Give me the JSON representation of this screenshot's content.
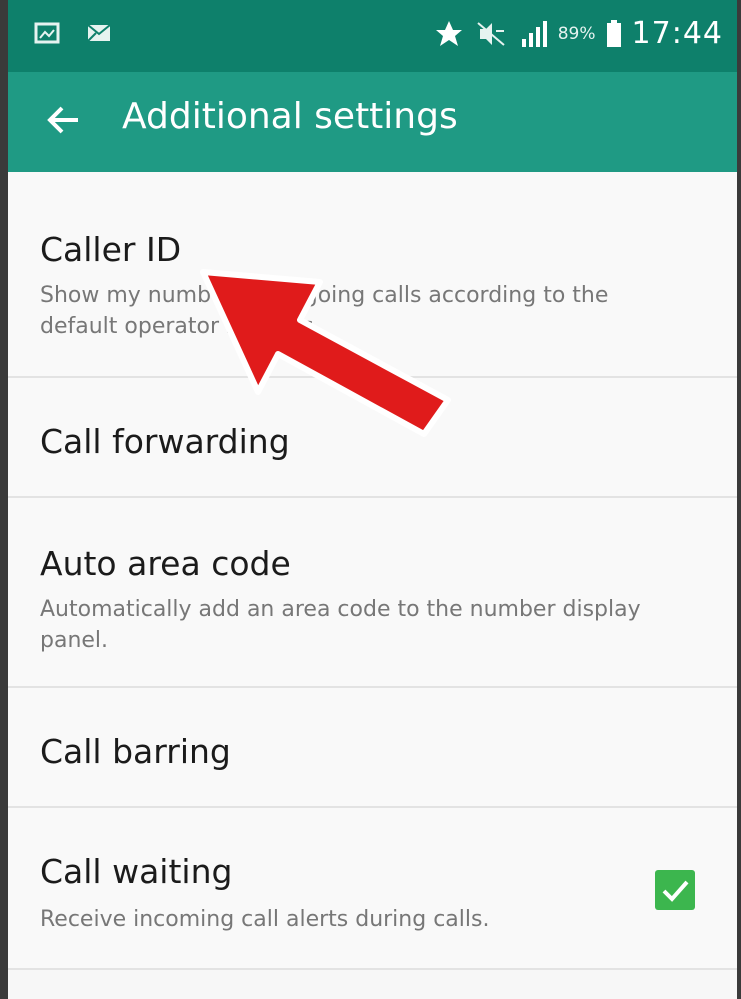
{
  "status_bar": {
    "left_icons": [
      "image-notification-icon",
      "mail-notification-icon"
    ],
    "right_icons": [
      "star-icon",
      "mute-icon",
      "signal-icon",
      "battery-icon"
    ],
    "battery": "89%",
    "time": "17:44"
  },
  "app_bar": {
    "back_icon": "arrow-left-icon",
    "title": "Additional settings",
    "color": "#1f9a84"
  },
  "settings": [
    {
      "title": "Caller ID",
      "subtitle": "Show my number in outgoing calls according to the default operator settings."
    },
    {
      "title": "Call forwarding",
      "subtitle": ""
    },
    {
      "title": "Auto area code",
      "subtitle": "Automatically add an area code to the number display panel."
    },
    {
      "title": "Call barring",
      "subtitle": ""
    },
    {
      "title": "Call waiting",
      "subtitle": "Receive incoming call alerts during calls.",
      "checked": true
    }
  ],
  "annotation": {
    "type": "red-arrow-pointing-to-caller-id",
    "color": "#e01b1b"
  }
}
